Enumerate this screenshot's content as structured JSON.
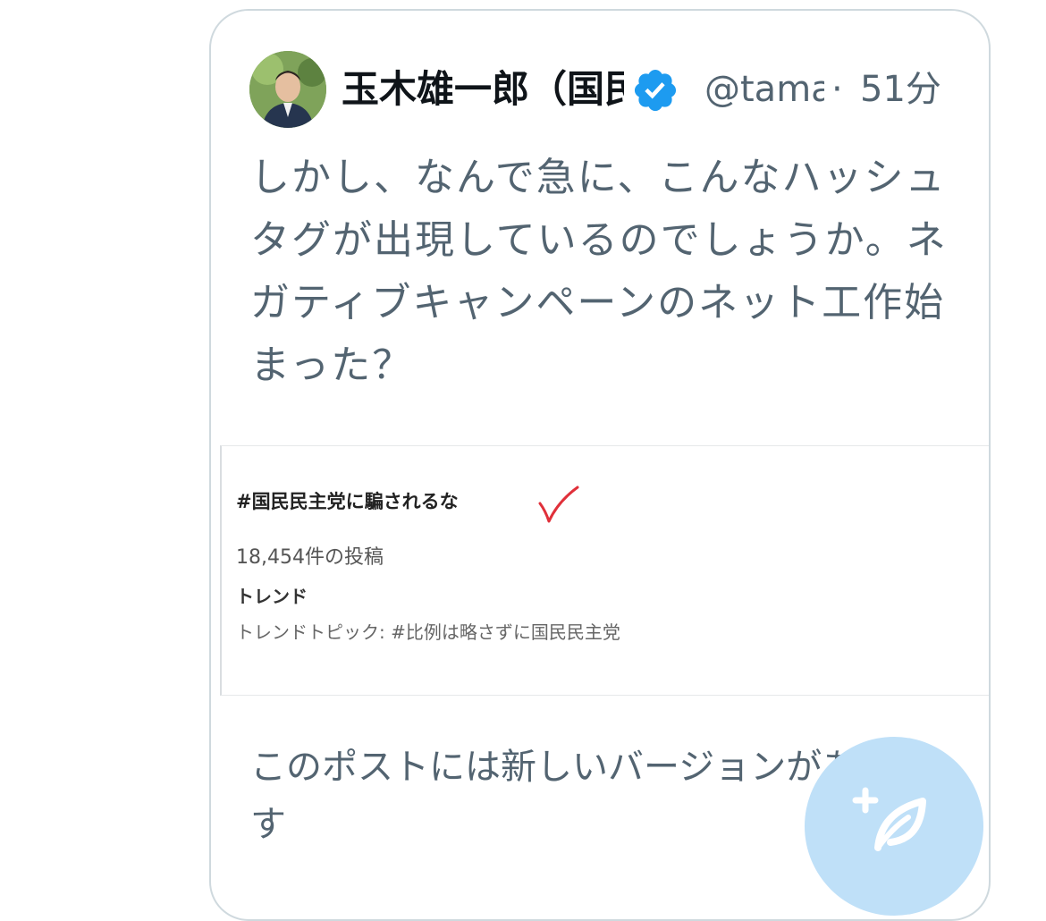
{
  "post": {
    "author_name": "玉木雄一郎（国民民主党",
    "handle": "@tamakiyuichiro",
    "separator": "·",
    "time": "51分",
    "text": "しかし、なんで急に、こんなハッシュタグが出現しているのでしょうか。ネガティブキャンペーンのネット工作始まった？",
    "embed": {
      "hashtag": "#国民民主党に騙されるな",
      "post_count": "18,454件の投稿",
      "trend_label": "トレンド",
      "trend_topic": "トレンドトピック: #比例は略さずに国民民主党"
    },
    "new_version_notice": "このポストには新しいバージョンがあります"
  },
  "icons": {
    "verified": "verified-badge-icon",
    "compose": "compose-post-icon",
    "checkmark": "red-checkmark-icon"
  },
  "colors": {
    "verified_blue": "#1d9bf0",
    "secondary_text": "#536471",
    "fab": "#bfe0f8",
    "check_red": "#e0303a"
  }
}
